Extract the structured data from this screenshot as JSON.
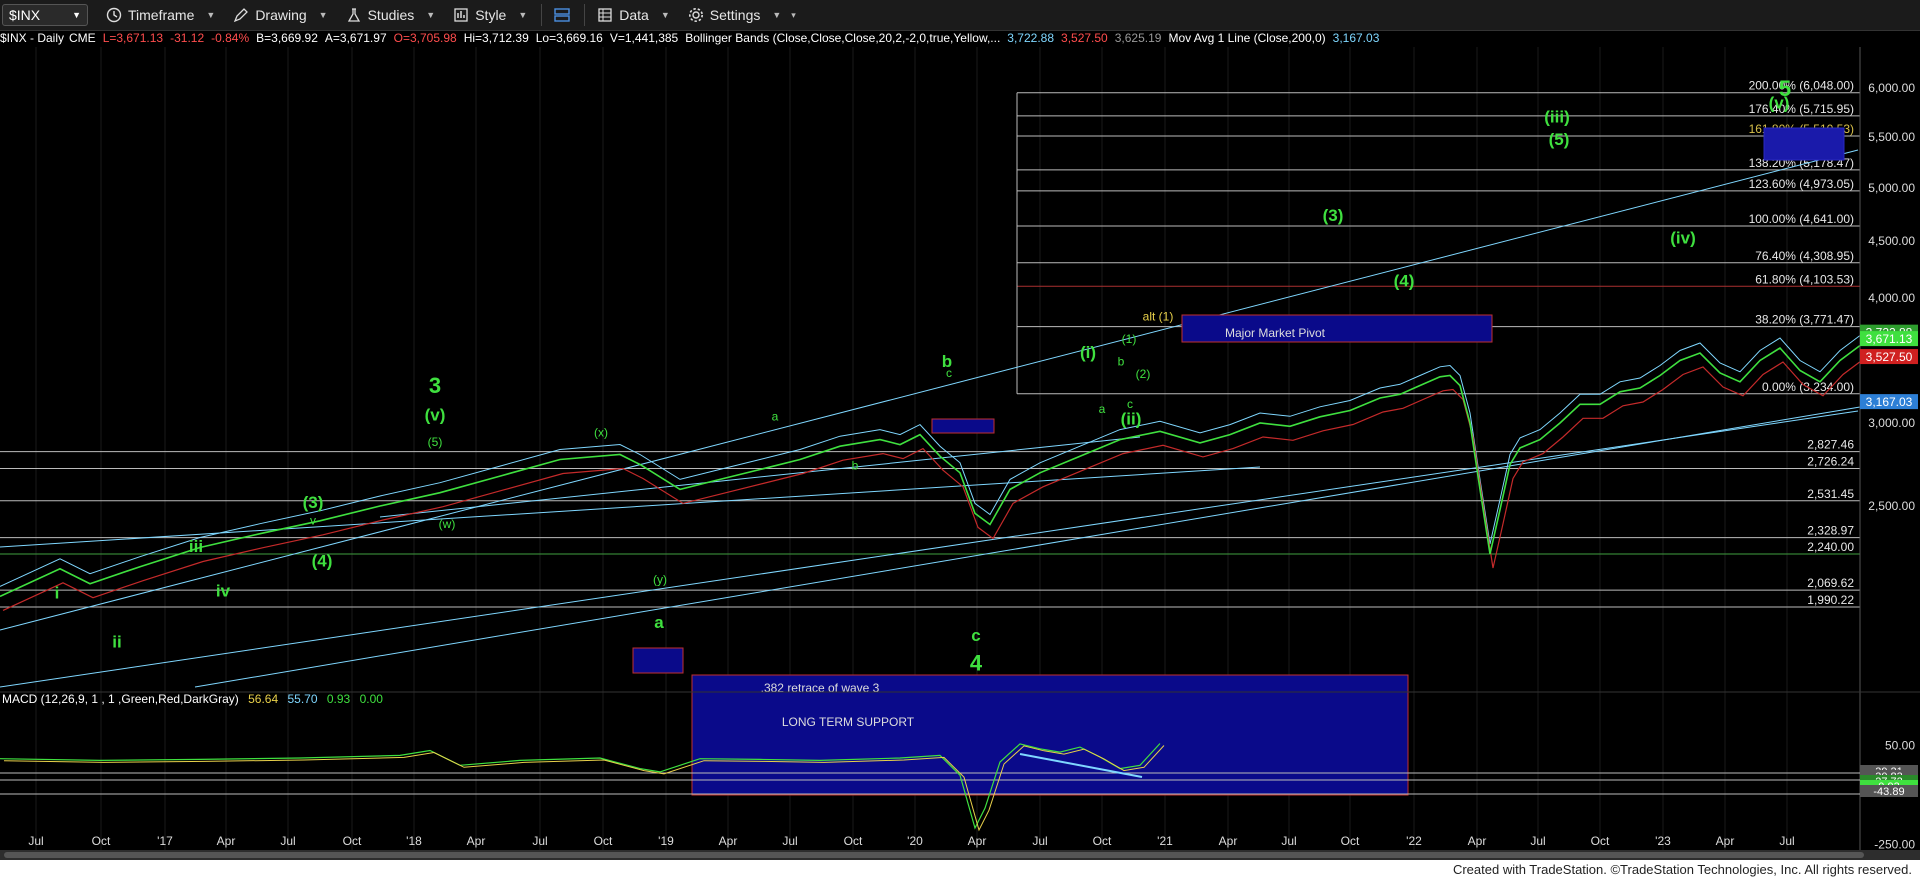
{
  "toolbar": {
    "symbol": "$INX",
    "timeframe": "Timeframe",
    "drawing": "Drawing",
    "studies": "Studies",
    "style": "Style",
    "data": "Data",
    "settings": "Settings"
  },
  "infobar": {
    "symbol": "$INX - Daily",
    "exchange": "CME",
    "last": "L=3,671.13",
    "change": "-31.12",
    "pct": "-0.84%",
    "bid": "B=3,669.92",
    "ask": "A=3,671.97",
    "open": "O=3,705.98",
    "high": "Hi=3,712.39",
    "low": "Lo=3,669.16",
    "volume": "V=1,441,385",
    "bb_label": "Bollinger Bands (Close,Close,Close,20,2,-2,0,true,Yellow,...",
    "bb_upper": "3,722.88",
    "bb_lower": "3,527.50",
    "bb_mid": "3,625.19",
    "ma_label": "Mov Avg 1 Line (Close,200,0)",
    "ma_value": "3,167.03"
  },
  "macd_header": {
    "label": "MACD (12,26,9, 1 , 1 ,Green,Red,DarkGray)",
    "v1": "56.64",
    "v2": "55.70",
    "v3": "0.93",
    "v4": "0.00"
  },
  "footer": "Created with TradeStation. ©TradeStation Technologies, Inc. All rights reserved.",
  "colors": {
    "price": "#3fe03f",
    "band": "#7fd7ff",
    "ma": "#c42a2a",
    "wave_green": "#3fe03f",
    "fib_text": "#e8e8e8",
    "fib_618": "#d8c04a",
    "box_fill": "#0a0a8a",
    "box_border": "#c03030"
  },
  "chart_data": {
    "type": "line",
    "title": "$INX - Daily",
    "ylim": [
      1990,
      6250
    ],
    "x_ticks": [
      "Jul",
      "Oct",
      "'17",
      "Apr",
      "Jul",
      "Oct",
      "'18",
      "Apr",
      "Jul",
      "Oct",
      "'19",
      "Apr",
      "Jul",
      "Oct",
      "'20",
      "Apr",
      "Jul",
      "Oct",
      "'21",
      "Apr",
      "Jul",
      "Oct",
      "'22",
      "Apr",
      "Jul",
      "Oct",
      "'23",
      "Apr",
      "Jul"
    ],
    "y_ticks": [
      "6,000.00",
      "5,500.00",
      "5,000.00",
      "4,500.00",
      "4,000.00",
      "3,000.00",
      "2,500.00"
    ],
    "x_start": "2016-05-15",
    "x_end": "2023-08-25",
    "series": [
      {
        "values": [
          [
            0,
            2040
          ],
          [
            60,
            2170
          ],
          [
            90,
            2100
          ],
          [
            140,
            2180
          ],
          [
            200,
            2275
          ],
          [
            260,
            2350
          ],
          [
            320,
            2420
          ],
          [
            380,
            2500
          ],
          [
            440,
            2580
          ],
          [
            500,
            2680
          ],
          [
            560,
            2780
          ],
          [
            620,
            2810
          ],
          [
            640,
            2750
          ],
          [
            680,
            2600
          ],
          [
            720,
            2660
          ],
          [
            760,
            2720
          ],
          [
            800,
            2780
          ],
          [
            840,
            2860
          ],
          [
            880,
            2900
          ],
          [
            900,
            2870
          ],
          [
            920,
            2930
          ],
          [
            940,
            2800
          ],
          [
            960,
            2700
          ],
          [
            975,
            2460
          ],
          [
            990,
            2400
          ],
          [
            1010,
            2600
          ],
          [
            1040,
            2700
          ],
          [
            1080,
            2800
          ],
          [
            1120,
            2900
          ],
          [
            1160,
            2950
          ],
          [
            1200,
            2880
          ],
          [
            1230,
            2930
          ],
          [
            1260,
            3000
          ],
          [
            1290,
            2980
          ],
          [
            1320,
            3050
          ],
          [
            1350,
            3100
          ],
          [
            1380,
            3200
          ],
          [
            1400,
            3230
          ],
          [
            1420,
            3300
          ],
          [
            1440,
            3370
          ],
          [
            1450,
            3380
          ],
          [
            1460,
            3300
          ],
          [
            1470,
            3000
          ],
          [
            1480,
            2600
          ],
          [
            1490,
            2240
          ],
          [
            1500,
            2480
          ],
          [
            1510,
            2750
          ],
          [
            1520,
            2850
          ],
          [
            1540,
            2900
          ],
          [
            1560,
            3000
          ],
          [
            1580,
            3150
          ],
          [
            1600,
            3150
          ],
          [
            1620,
            3250
          ],
          [
            1640,
            3280
          ],
          [
            1660,
            3380
          ],
          [
            1680,
            3500
          ],
          [
            1700,
            3560
          ],
          [
            1720,
            3400
          ],
          [
            1740,
            3330
          ],
          [
            1760,
            3500
          ],
          [
            1780,
            3600
          ],
          [
            1800,
            3420
          ],
          [
            1820,
            3330
          ],
          [
            1840,
            3500
          ],
          [
            1860,
            3620
          ],
          [
            1880,
            3700
          ],
          [
            1890,
            3671
          ]
        ],
        "name": "$INX - Daily"
      }
    ],
    "fib_levels": [
      {
        "label": "200.00% (6,048.00)",
        "value": 6048
      },
      {
        "label": "176.40% (5,715.95)",
        "value": 5716
      },
      {
        "label": "161.80% (5,510.53)",
        "value": 5510
      },
      {
        "label": "138.20% (5,178.47)",
        "value": 5178
      },
      {
        "label": "123.60% (4,973.05)",
        "value": 4973
      },
      {
        "label": "100.00% (4,641.00)",
        "value": 4641
      },
      {
        "label": "76.40% (4,308.95)",
        "value": 4309
      },
      {
        "label": "61.80% (4,103.53)",
        "value": 4103
      },
      {
        "label": "38.20% (3,771.47)",
        "value": 3771
      },
      {
        "label": "0.00% (3,234.00)",
        "value": 3234
      }
    ],
    "support_levels": [
      {
        "label": "2,827.46",
        "value": 2827.46
      },
      {
        "label": "2,726.24",
        "value": 2726.24
      },
      {
        "label": "2,531.45",
        "value": 2531.45
      },
      {
        "label": "2,328.97",
        "value": 2328.97
      },
      {
        "label": "2,240.00",
        "value": 2240.0
      },
      {
        "label": "2,069.62",
        "value": 2069.62
      },
      {
        "label": "1,990.22",
        "value": 1990.22
      }
    ],
    "price_tags": [
      {
        "label": "3,722.88",
        "value": 3722.88,
        "color": "#2e9e2e"
      },
      {
        "label": "3,671.13",
        "value": 3671.13,
        "color": "#3fe03f"
      },
      {
        "label": "3,527.50",
        "value": 3527.5,
        "color": "#d02020"
      },
      {
        "label": "3,167.03",
        "value": 3167.03,
        "color": "#2d7fd6"
      }
    ],
    "wave_labels": [
      {
        "text": "3",
        "x": 435,
        "y": 3240,
        "size": "big"
      },
      {
        "text": "(v)",
        "x": 435,
        "y": 3020,
        "size": "mid"
      },
      {
        "text": "(5)",
        "x": 435,
        "y": 2860,
        "size": "sm"
      },
      {
        "text": "(3)",
        "x": 313,
        "y": 2490,
        "size": "mid"
      },
      {
        "text": "v",
        "x": 313,
        "y": 2400,
        "size": "sm"
      },
      {
        "text": "(4)",
        "x": 322,
        "y": 2180,
        "size": "mid"
      },
      {
        "text": "iii",
        "x": 196,
        "y": 2250,
        "size": "mid"
      },
      {
        "text": "iv",
        "x": 223,
        "y": 2040,
        "size": "mid"
      },
      {
        "text": "i",
        "x": 57,
        "y": 2030,
        "size": "mid"
      },
      {
        "text": "ii",
        "x": 117,
        "y": 1800,
        "size": "mid"
      },
      {
        "text": "(w)",
        "x": 447,
        "y": 2380,
        "size": "sm"
      },
      {
        "text": "(x)",
        "x": 601,
        "y": 2920,
        "size": "sm"
      },
      {
        "text": "(y)",
        "x": 660,
        "y": 2100,
        "size": "sm"
      },
      {
        "text": "a",
        "x": 659,
        "y": 1890,
        "size": "mid"
      },
      {
        "text": "a",
        "x": 775,
        "y": 3020,
        "size": "sm"
      },
      {
        "text": "b",
        "x": 855,
        "y": 2720,
        "size": "sm"
      },
      {
        "text": "b",
        "x": 947,
        "y": 3450,
        "size": "mid"
      },
      {
        "text": "c",
        "x": 949,
        "y": 3370,
        "size": "sm"
      },
      {
        "text": "c",
        "x": 976,
        "y": 1830,
        "size": "mid"
      },
      {
        "text": "4",
        "x": 976,
        "y": 1690,
        "size": "big"
      },
      {
        "text": "(i)",
        "x": 1088,
        "y": 3520,
        "size": "mid"
      },
      {
        "text": "b",
        "x": 1121,
        "y": 3460,
        "size": "sm"
      },
      {
        "text": "a",
        "x": 1102,
        "y": 3080,
        "size": "sm"
      },
      {
        "text": "c",
        "x": 1130,
        "y": 3120,
        "size": "sm"
      },
      {
        "text": "(ii)",
        "x": 1131,
        "y": 2990,
        "size": "mid"
      },
      {
        "text": "(1)",
        "x": 1129,
        "y": 3640,
        "size": "sm"
      },
      {
        "text": "(2)",
        "x": 1143,
        "y": 3360,
        "size": "sm"
      },
      {
        "text": "alt (1)",
        "x": 1158,
        "y": 3820,
        "size": "sm",
        "color": "#e8d04a"
      },
      {
        "text": "(3)",
        "x": 1333,
        "y": 4690,
        "size": "mid"
      },
      {
        "text": "(4)",
        "x": 1404,
        "y": 4100,
        "size": "mid"
      },
      {
        "text": "(iii)",
        "x": 1557,
        "y": 5650,
        "size": "mid"
      },
      {
        "text": "(5)",
        "x": 1559,
        "y": 5420,
        "size": "mid"
      },
      {
        "text": "(iv)",
        "x": 1683,
        "y": 4480,
        "size": "mid"
      },
      {
        "text": "5",
        "x": 1785,
        "y": 6080,
        "size": "big"
      },
      {
        "text": "(v)",
        "x": 1779,
        "y": 5790,
        "size": "mid"
      }
    ],
    "box_labels": {
      "pivot": "Major Market Pivot",
      "retrace": ".382 retrace of wave 3",
      "support": "LONG TERM SUPPORT"
    },
    "macd": {
      "ylim": [
        -300,
        100
      ],
      "y_ticks": [
        "50.00",
        "-50.00",
        "-250.00"
      ],
      "tags": [
        "39.21",
        "30.83",
        "27.72",
        "0.93",
        "-43.89"
      ],
      "values": [
        [
          0,
          10
        ],
        [
          100,
          5
        ],
        [
          200,
          8
        ],
        [
          300,
          12
        ],
        [
          400,
          20
        ],
        [
          430,
          35
        ],
        [
          460,
          -10
        ],
        [
          520,
          5
        ],
        [
          600,
          12
        ],
        [
          640,
          -20
        ],
        [
          660,
          -30
        ],
        [
          700,
          10
        ],
        [
          760,
          8
        ],
        [
          820,
          5
        ],
        [
          900,
          12
        ],
        [
          940,
          20
        ],
        [
          960,
          -40
        ],
        [
          975,
          -200
        ],
        [
          985,
          -140
        ],
        [
          1000,
          0
        ],
        [
          1020,
          55
        ],
        [
          1040,
          40
        ],
        [
          1060,
          30
        ],
        [
          1080,
          45
        ],
        [
          1100,
          15
        ],
        [
          1120,
          -20
        ],
        [
          1140,
          -10
        ],
        [
          1160,
          56
        ]
      ]
    }
  }
}
